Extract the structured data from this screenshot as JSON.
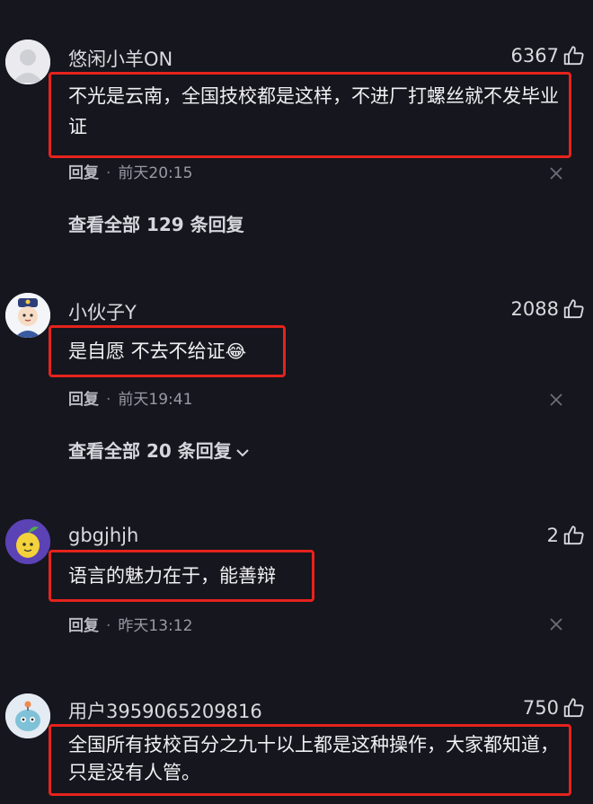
{
  "comments": [
    {
      "username": "悠闲小羊ON",
      "likes": "6367",
      "text": "不光是云南，全国技校都是这样，不进厂打螺丝就不发毕业证",
      "reply_label": "回复",
      "time": "前天20:15",
      "view_all": "查看全部 129 条回复"
    },
    {
      "username": "小伙子Y",
      "likes": "2088",
      "text": "是自愿 不去不给证",
      "emoji": "😂",
      "reply_label": "回复",
      "time": "前天19:41",
      "view_all": "查看全部 20 条回复"
    },
    {
      "username": "gbgjhjh",
      "likes": "2",
      "text": "语言的魅力在于，能善辩",
      "reply_label": "回复",
      "time": "昨天13:12"
    },
    {
      "username": "用户3959065209816",
      "likes": "750",
      "text": "全国所有技校百分之九十以上都是这种操作，大家都知道，只是没有人管。"
    }
  ],
  "icons": {
    "like": "thumbs-up-icon",
    "close": "close-icon",
    "expand": "chevron-down-icon"
  },
  "colors": {
    "background": "#16161e",
    "highlight": "#e5231c",
    "text": "#f1f1f4",
    "meta": "#9a9aa4"
  }
}
